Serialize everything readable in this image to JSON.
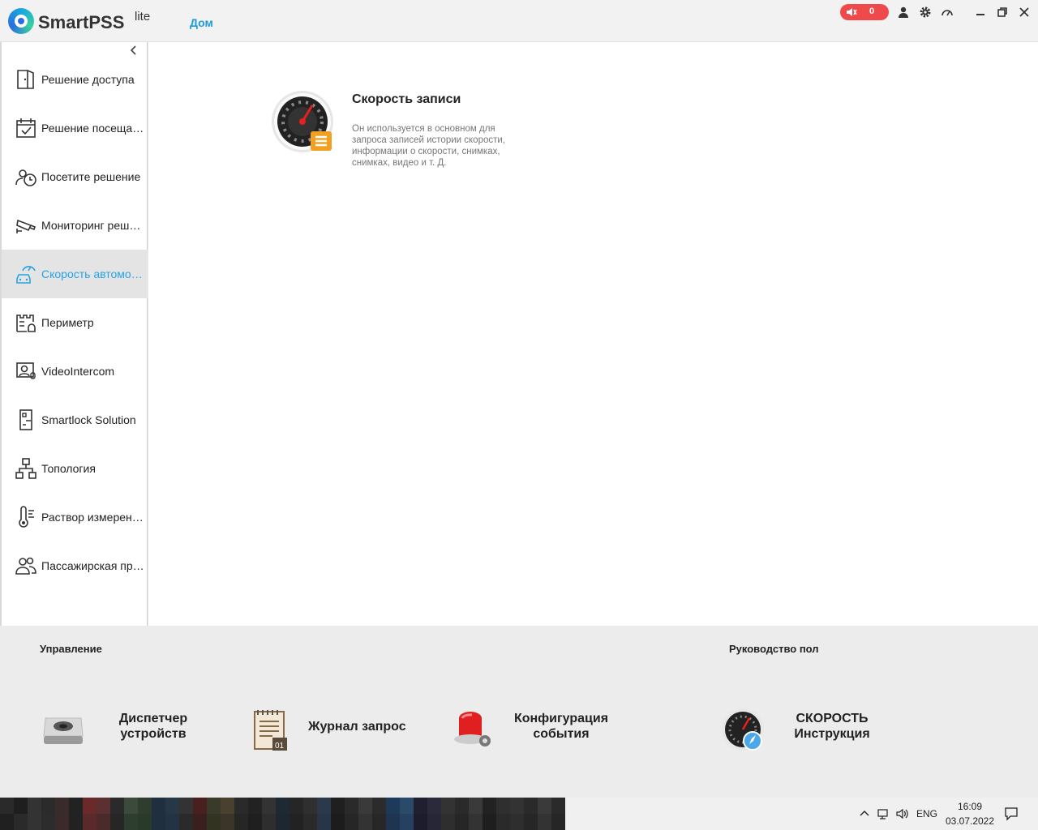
{
  "app": {
    "name": "SmartPSS",
    "edition": "lite",
    "home_tab": "Дом"
  },
  "titlebar": {
    "alarm_count": "0",
    "colors": {
      "alarm": "#f0494b",
      "accent": "#1e9be0"
    }
  },
  "sidebar": {
    "items": [
      {
        "label": "Решение доступа",
        "icon": "door-icon"
      },
      {
        "label": "Решение посещаемости",
        "icon": "calendar-check-icon"
      },
      {
        "label": "Посетите решение",
        "icon": "visitor-clock-icon"
      },
      {
        "label": "Мониторинг решений",
        "icon": "cctv-camera-icon"
      },
      {
        "label": "Скорость автомобиля",
        "icon": "car-speed-icon",
        "active": true
      },
      {
        "label": "Периметр",
        "icon": "perimeter-icon"
      },
      {
        "label": "VideoIntercom",
        "icon": "intercom-icon"
      },
      {
        "label": "Smartlock Solution",
        "icon": "smartlock-icon"
      },
      {
        "label": "Топология",
        "icon": "topology-icon"
      },
      {
        "label": "Раствор измерения температуры",
        "icon": "thermometer-icon"
      },
      {
        "label": "Пассажирская пропускная способность",
        "icon": "people-icon"
      }
    ]
  },
  "main": {
    "card": {
      "title": "Скорость записи",
      "description": "Он используется в основном для запроса записей истории скорости, информации о скорости, снимках, снимках, видео и т. Д."
    }
  },
  "bottom": {
    "management_label": "Управление",
    "guide_label": "Руководство пол",
    "tools": [
      {
        "line1": "Диспетчер",
        "line2": "устройств",
        "icon": "device-manager-icon"
      },
      {
        "line1": "Журнал запрос",
        "line2": "",
        "icon": "log-icon"
      },
      {
        "line1": "Конфигурация",
        "line2": "события",
        "icon": "alarm-siren-icon"
      },
      {
        "line1": "СКОРОСТЬ",
        "line2": "Инструкция",
        "icon": "speed-guide-icon"
      }
    ]
  },
  "taskbar": {
    "lang": "ENG",
    "time": "16:09",
    "date": "03.07.2022"
  }
}
